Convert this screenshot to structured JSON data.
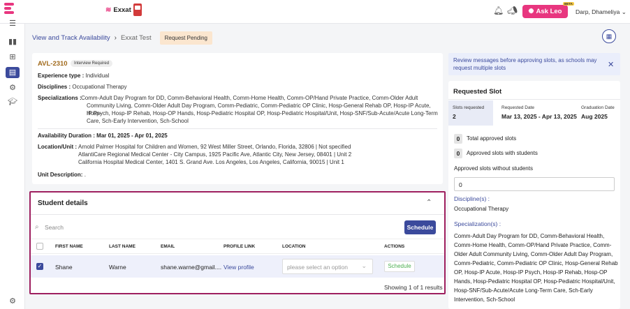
{
  "header": {
    "brand_name": "Exxat",
    "ask_leo_label": "Ask Leo",
    "beta_label": "BETA",
    "user_name": "Darp, Dhameliya"
  },
  "breadcrumb": {
    "root": "View and Track Availability",
    "current": "Exxat Test",
    "status_badge": "Request Pending"
  },
  "availability": {
    "code": "AVL-2310",
    "tag": "Interview Required",
    "experience_label": "Experience type :",
    "experience_value": "Individual",
    "disciplines_label": "Disciplines :",
    "disciplines_value": "Occupational Therapy",
    "specializations_label": "Specializations :",
    "specializations_lines": [
      "Comm-Adult Day Program for DD, Comm-Behavioral Health, Comm-Home Health, Comm-OP/Hand Private Practice, Comm-Older Adult",
      "Community Living, Comm-Older Adult Day Program, Comm-Pediatric, Comm-Pediatric OP Clinic, Hosp-General Rehab OP, Hosp-IP Acute, Hosp-",
      "IP Psych, Hosp-IP Rehab, Hosp-OP Hands, Hosp-Pediatric Hospital OP, Hosp-Pediatric Hospital/Unit, Hosp-SNF/Sub-Acute/Acute Long-Term",
      "Care, Sch-Early Intervention, Sch-School"
    ],
    "duration_label": "Availability Duration :",
    "duration_value": "Mar 01, 2025 - Apr 01, 2025",
    "location_label": "Location/Unit :",
    "location_lines": [
      "Arnold Palmer Hospital for Children and Women, 92 West Miller Street, Orlando, Florida, 32806 | Not specified",
      "AtlantiCare Regional Medical Center - City Campus, 1925 Pacific Ave, Atlantic City, New Jersey, 08401 | Unit 2",
      "California Hospital Medical Center, 1401 S. Grand Ave. Los Angeles, Los Angeles, California, 90015 | Unit 1"
    ],
    "unit_desc_label": "Unit Description:",
    "unit_desc_value": "."
  },
  "student_details": {
    "title": "Student details",
    "search_placeholder": "Search",
    "schedule_button": "Schedule",
    "columns": [
      "FIRST NAME",
      "LAST NAME",
      "EMAIL",
      "PROFILE LINK",
      "LOCATION",
      "ACTIONS"
    ],
    "row": {
      "first_name": "Shane",
      "last_name": "Warne",
      "email": "shane.warne@gmail....",
      "profile_link": "View profile",
      "location_placeholder": "please select an option",
      "action": "Schedule"
    },
    "showing": "Showing 1 of 1 results"
  },
  "notice": {
    "text": "Review messages before approving slots, as schools may request multiple slots"
  },
  "requested_slot": {
    "title": "Requested Slot",
    "slots_label": "Slots requested",
    "slots_value": "2",
    "requested_date_label": "Requested Date",
    "requested_date_value": "Mar 13, 2025 - Apr 13, 2025",
    "graduation_label": "Graduation Date",
    "graduation_value": "Aug 2025",
    "total_approved_count": "0",
    "total_approved_label": "Total approved slots",
    "approved_with_students_count": "0",
    "approved_with_students_label": "Approved slots with students",
    "approved_without_label": "Approved slots without students",
    "approved_without_value": "0",
    "disciplines_heading": "Discipline(s) :",
    "disciplines_value": "Occupational Therapy",
    "specializations_heading": "Specialization(s) :",
    "specializations_value": "Comm-Adult Day Program for DD, Comm-Behavioral Health, Comm-Home Health, Comm-OP/Hand Private Practice, Comm-Older Adult Community Living, Comm-Older Adult Day Program, Comm-Pediatric, Comm-Pediatric OP Clinic, Hosp-General Rehab OP, Hosp-IP Acute, Hosp-IP Psych, Hosp-IP Rehab, Hosp-OP Hands, Hosp-Pediatric Hospital OP, Hosp-Pediatric Hospital/Unit, Hosp-SNF/Sub-Acute/Acute Long-Term Care, Sch-Early Intervention, Sch-School"
  },
  "colors": {
    "accent": "#3b4a9c",
    "brand_pink": "#e8367f",
    "highlight_border": "#9e1f5f"
  }
}
